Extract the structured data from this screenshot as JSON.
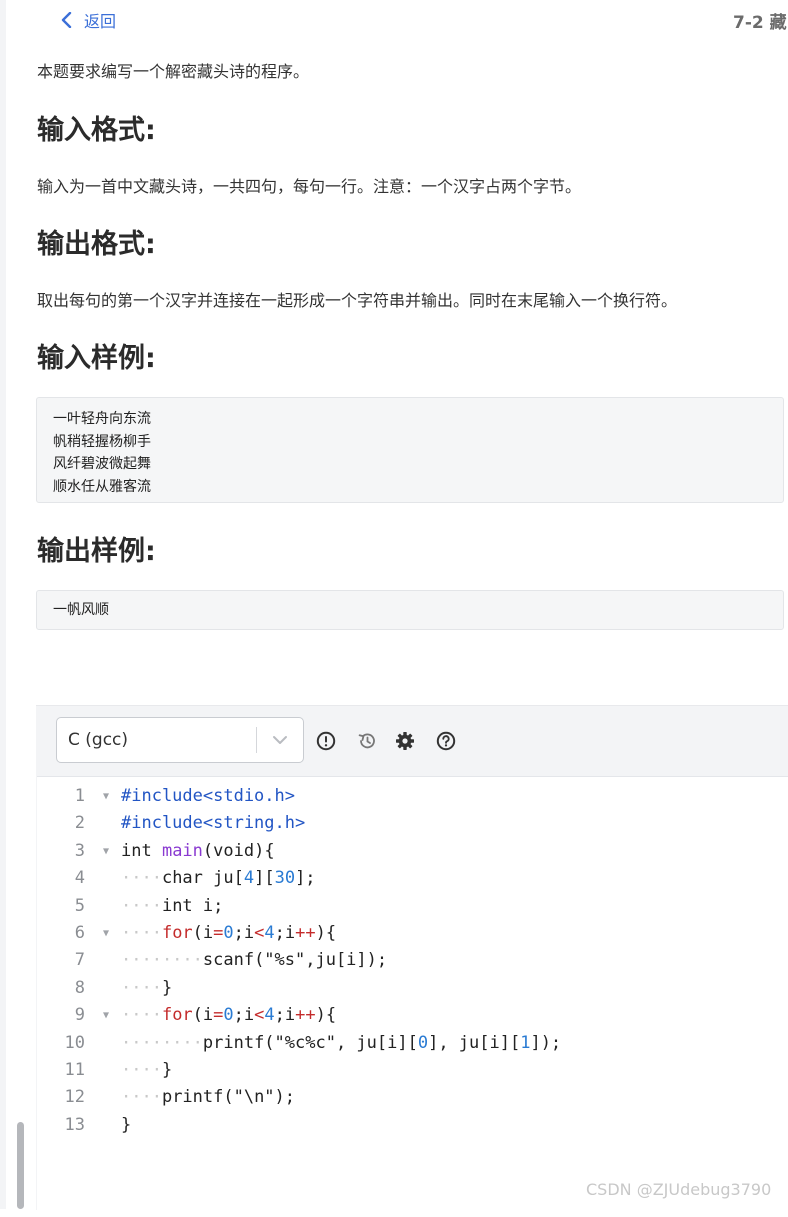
{
  "header": {
    "back_label": "返回",
    "title": "7-2 藏"
  },
  "problem": {
    "intro": "本题要求编写一个解密藏头诗的程序。",
    "input_heading": "输入格式:",
    "input_text": "输入为一首中文藏头诗，一共四句，每句一行。注意：一个汉字占两个字节。",
    "output_heading": "输出格式:",
    "output_text": "取出每句的第一个汉字并连接在一起形成一个字符串并输出。同时在末尾输入一个换行符。",
    "sample_input_heading": "输入样例:",
    "sample_input": [
      "一叶轻舟向东流",
      "帆稍轻握杨柳手",
      "风纤碧波微起舞",
      "顺水任从雅客流"
    ],
    "sample_output_heading": "输出样例:",
    "sample_output": [
      "一帆风顺"
    ]
  },
  "editor": {
    "language": "C (gcc)",
    "toolbar_icons": [
      "exclamation-circle-icon",
      "history-icon",
      "gear-icon",
      "question-circle-icon"
    ],
    "lines": [
      "#include<stdio.h>",
      "#include<string.h>",
      "int main(void){",
      "    char ju[4][30];",
      "    int i;",
      "    for(i=0;i<4;i++){",
      "        scanf(\"%s\",ju[i]);",
      "    }",
      "    for(i=0;i<4;i++){",
      "        printf(\"%c%c\", ju[i][0], ju[i][1]);",
      "    }",
      "    printf(\"\\n\");",
      "}"
    ],
    "line_numbers": [
      "1",
      "2",
      "3",
      "4",
      "5",
      "6",
      "7",
      "8",
      "9",
      "10",
      "11",
      "12",
      "13"
    ]
  },
  "watermark": "CSDN @ZJUdebug3790",
  "colors": {
    "link": "#3b6fd8",
    "keyword": "#2255c4",
    "function": "#8a3ad1",
    "control": "#c42b2b",
    "number": "#2a7bd3"
  }
}
